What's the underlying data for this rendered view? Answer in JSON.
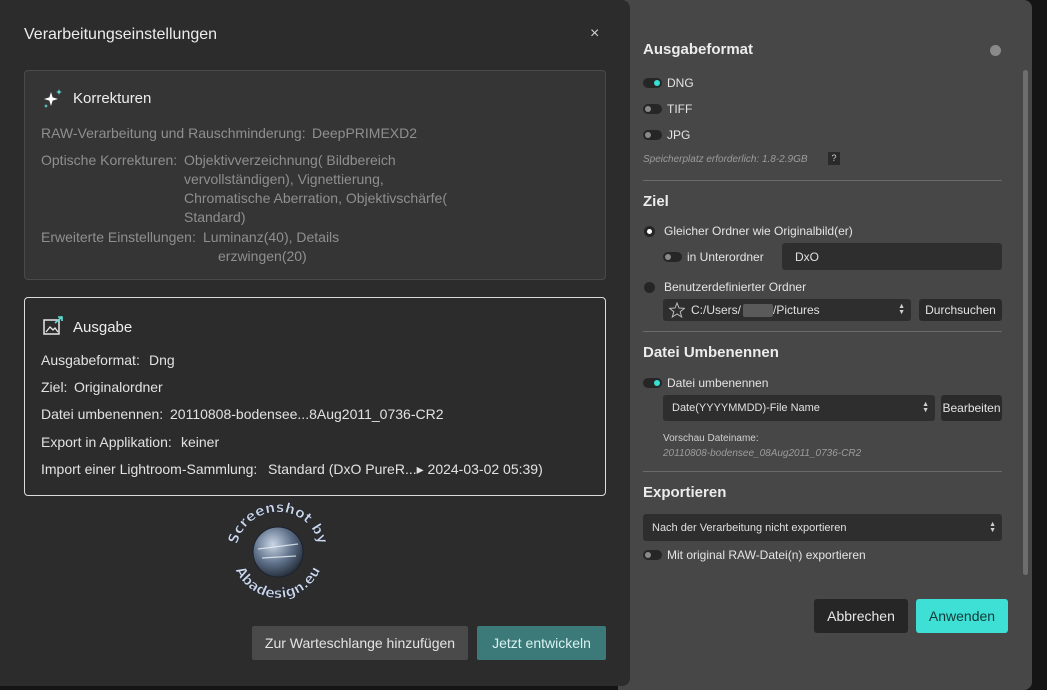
{
  "dialog": {
    "title": "Verarbeitungseinstellungen",
    "close_label": "×",
    "korrekturen": {
      "title": "Korrekturen",
      "raw_label": "RAW-Verarbeitung und Rauschminderung:",
      "raw_value": "DeepPRIMEXD2",
      "optical_label": "Optische Korrekturen:",
      "optical_lines": [
        "Objektivverzeichnung( Bildbereich",
        "vervollständigen), Vignettierung,",
        "Chromatische Aberration, Objektivschärfe(",
        "Standard)"
      ],
      "advanced_label": "Erweiterte Einstellungen:",
      "advanced_lines": [
        "Luminanz(40), Details",
        "erzwingen(20)"
      ]
    },
    "ausgabe": {
      "title": "Ausgabe",
      "format_label": "Ausgabeformat:",
      "format_value": "Dng",
      "target_label": "Ziel:",
      "target_value": "Originalordner",
      "rename_label": "Datei umbenennen:",
      "rename_value": "20110808-bodensee...8Aug2011_0736-CR2",
      "export_label": "Export in Applikation:",
      "export_value": "keiner",
      "import_label": "Import einer Lightroom-Sammlung:",
      "import_value": "Standard (DxO PureR...▸ 2024-03-02 05:39)"
    },
    "watermark": {
      "top_text": "Screenshot by",
      "bottom_text": "Abadesign.eu"
    },
    "queue_button": "Zur Warteschlange hinzufügen",
    "develop_button": "Jetzt entwickeln"
  },
  "panel": {
    "ausgabeformat": {
      "title": "Ausgabeformat",
      "formats": [
        {
          "label": "DNG",
          "on": true
        },
        {
          "label": "TIFF",
          "on": false
        },
        {
          "label": "JPG",
          "on": false
        }
      ],
      "storage_note": "Speicherplatz erforderlich: 1.8-2.9GB",
      "help": "?"
    },
    "ziel": {
      "title": "Ziel",
      "same_folder": "Gleicher Ordner wie Originalbild(er)",
      "subfolder_label": "in Unterordner",
      "subfolder_value": "DxO",
      "custom_folder": "Benutzerdefinierter Ordner",
      "path_prefix": "C:/Users/",
      "path_suffix": "/Pictures",
      "browse": "Durchsuchen"
    },
    "umbenennen": {
      "title": "Datei Umbenennen",
      "toggle_label": "Datei umbenennen",
      "pattern": "Date(YYYYMMDD)-File Name",
      "edit": "Bearbeiten",
      "preview_label": "Vorschau Dateiname:",
      "preview_value": "20110808-bodensee_08Aug2011_0736-CR2"
    },
    "exportieren": {
      "title": "Exportieren",
      "select_value": "Nach der Verarbeitung nicht exportieren",
      "raw_toggle_label": "Mit original RAW-Datei(n) exportieren"
    },
    "cancel": "Abbrechen",
    "apply": "Anwenden"
  },
  "colors": {
    "accent": "#3ee0d6",
    "develop_button": "#3b7a78"
  }
}
